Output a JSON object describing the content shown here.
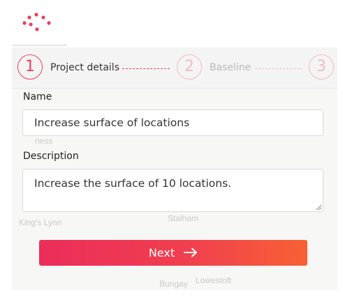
{
  "stepper": {
    "steps": [
      {
        "number": "1",
        "label": "Project details"
      },
      {
        "number": "2",
        "label": "Baseline"
      },
      {
        "number": "3",
        "label": ""
      }
    ]
  },
  "form": {
    "name_label": "Name",
    "name_value": "Increase surface of locations",
    "description_label": "Description",
    "description_value": "Increase the surface of 10 locations.",
    "next_label": "Next"
  },
  "map": {
    "places": [
      "King's Lynn",
      "Stalham",
      "Bungay",
      "Lowestoft",
      "ness"
    ]
  },
  "colors": {
    "accent": "#e8405a",
    "accent_light": "#f2b9c3",
    "button_start": "#ec2d5a",
    "button_end": "#f86133"
  }
}
